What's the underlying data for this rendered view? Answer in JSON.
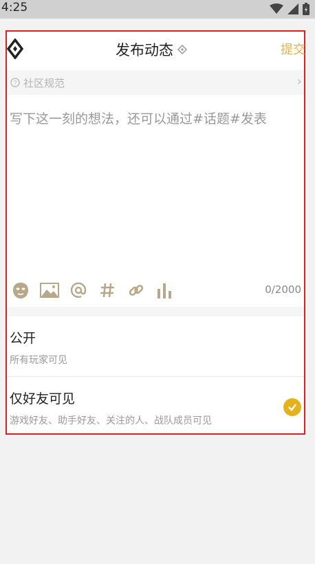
{
  "status_bar": {
    "time": "4:25"
  },
  "header": {
    "title": "发布动态",
    "submit_label": "提交"
  },
  "rules": {
    "label": "社区规范"
  },
  "editor": {
    "placeholder": "写下这一刻的想法，还可以通过#话题#发表",
    "counter": "0/2000"
  },
  "toolbar": {
    "icons": [
      "emoji-icon",
      "image-icon",
      "at-icon",
      "hashtag-icon",
      "link-icon",
      "chart-icon"
    ]
  },
  "visibility": {
    "options": [
      {
        "title": "公开",
        "subtitle": "所有玩家可见",
        "selected": false
      },
      {
        "title": "仅好友可见",
        "subtitle": "游戏好友、助手好友、关注的人、战队成员可见",
        "selected": true
      }
    ]
  },
  "colors": {
    "accent": "#e6b347",
    "check": "#e6b21c",
    "highlight_border": "#e21b1b"
  }
}
